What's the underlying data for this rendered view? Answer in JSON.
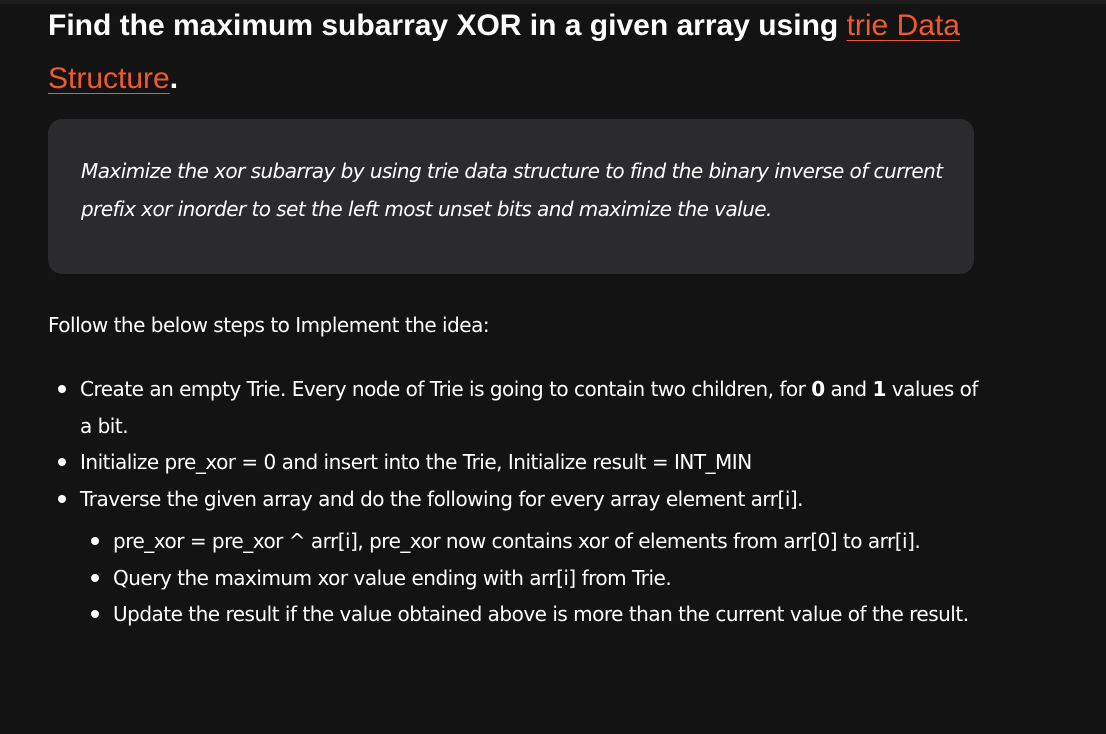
{
  "heading": {
    "text_before_link": "Find the maximum subarray XOR in a given array using ",
    "link_text": "trie Data Structure",
    "text_after_link": "."
  },
  "blockquote": {
    "text": "Maximize the xor subarray by using trie data structure to find the binary inverse of current prefix xor inorder to set the left most unset bits and maximize the value."
  },
  "intro": "Follow the below steps to Implement the idea:",
  "steps": [
    {
      "part1": "Create an empty Trie. Every node of Trie is going to contain two children, for ",
      "bold1": "0",
      "part2": " and ",
      "bold2": "1",
      "part3": " values of a bit."
    },
    {
      "text": "Initialize pre_xor = 0 and insert into the Trie, Initialize result = INT_MIN"
    },
    {
      "text": "Traverse the given array and do the following for every array element arr[i]."
    }
  ],
  "substeps": [
    {
      "text": "pre_xor  = pre_xor  ^ arr[i], pre_xor now contains xor of elements from arr[0] to arr[i]."
    },
    {
      "text": "Query the maximum xor value ending with arr[i] from Trie."
    },
    {
      "text": "Update the result if the value obtained above is more than the current value of the result."
    }
  ]
}
